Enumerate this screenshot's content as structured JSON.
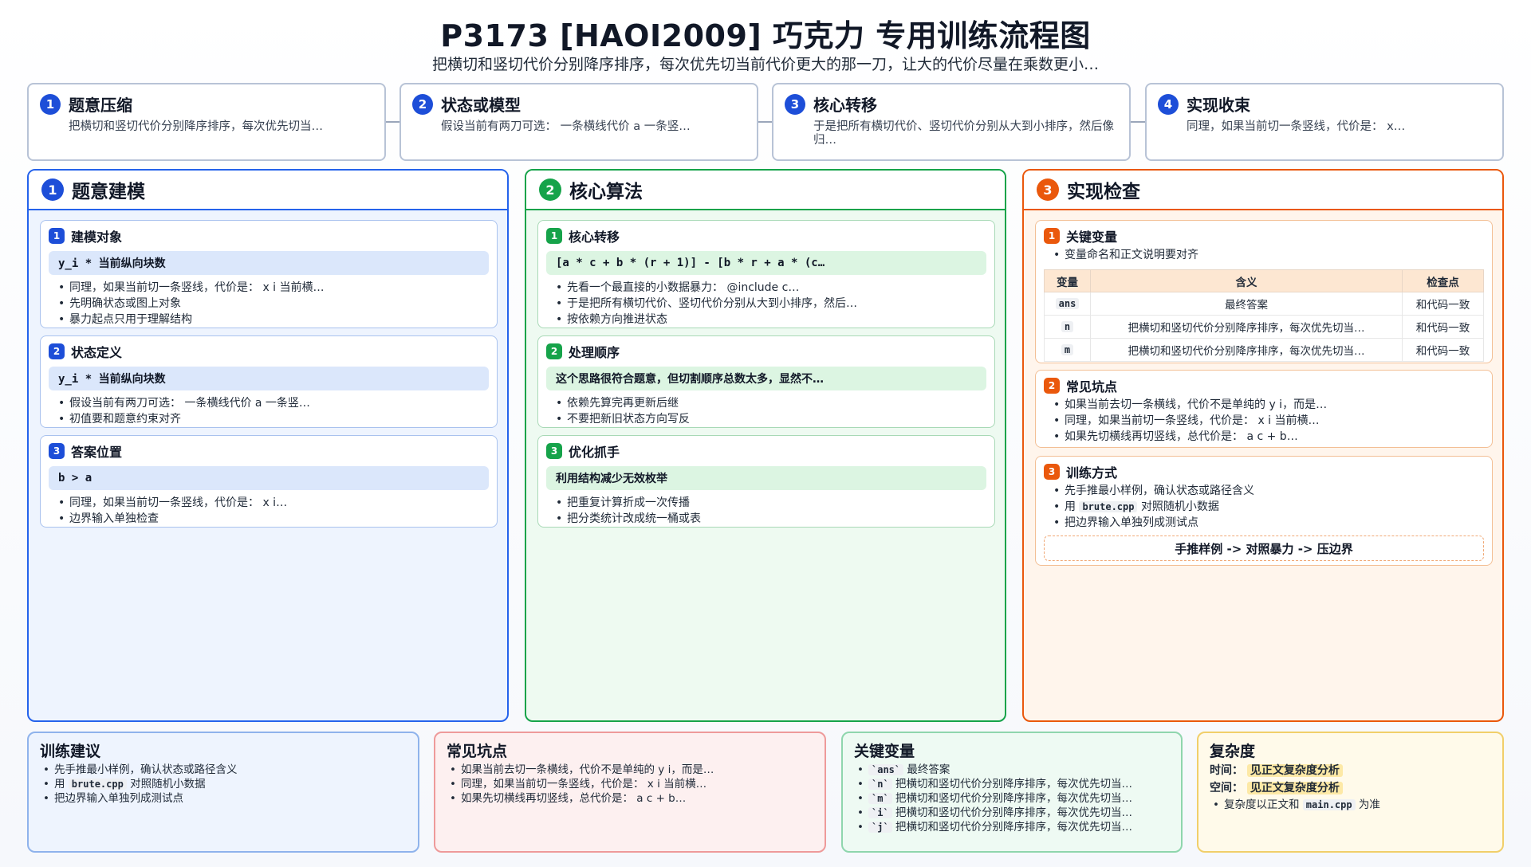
{
  "header": {
    "title": "P3173 [HAOI2009] 巧克力 专用训练流程图",
    "subtitle": "把横切和竖切代价分别降序排序，每次优先切当前代价更大的那一刀，让大的代价尽量在乘数更小…"
  },
  "steps": [
    {
      "num": "1",
      "title": "题意压缩",
      "desc": "把横切和竖切代价分别降序排序，每次优先切当…"
    },
    {
      "num": "2",
      "title": "状态或模型",
      "desc": "假设当前有两刀可选： 一条横线代价 a 一条竖…"
    },
    {
      "num": "3",
      "title": "核心转移",
      "desc": "于是把所有横切代价、竖切代价分别从大到小排序，然后像归…"
    },
    {
      "num": "4",
      "title": "实现收束",
      "desc": "同理，如果当前切一条竖线，代价是： x…"
    }
  ],
  "columns": {
    "modeling": {
      "num": "1",
      "title": "题意建模",
      "cards": [
        {
          "num": "1",
          "title": "建模对象",
          "code": "y_i * 当前纵向块数",
          "items": [
            "同理，如果当前切一条竖线，代价是： x i 当前横…",
            "先明确状态或图上对象",
            "暴力起点只用于理解结构"
          ]
        },
        {
          "num": "2",
          "title": "状态定义",
          "code": "y_i * 当前纵向块数",
          "items": [
            "假设当前有两刀可选： 一条横线代价 a 一条竖…",
            "初值要和题意约束对齐"
          ]
        },
        {
          "num": "3",
          "title": "答案位置",
          "code": "b > a",
          "items": [
            "同理，如果当前切一条竖线，代价是： x i…",
            "边界输入单独检查"
          ]
        }
      ]
    },
    "algorithm": {
      "num": "2",
      "title": "核心算法",
      "cards": [
        {
          "num": "1",
          "title": "核心转移",
          "code": "[a * c + b * (r + 1)] - [b * r + a * (c…",
          "items": [
            "先看一个最直接的小数据暴力： @include c…",
            "于是把所有横切代价、竖切代价分别从大到小排序，然后…",
            "按依赖方向推进状态"
          ]
        },
        {
          "num": "2",
          "title": "处理顺序",
          "code": "这个思路很符合题意，但切割顺序总数太多，显然不…",
          "items": [
            "依赖先算完再更新后继",
            "不要把新旧状态方向写反"
          ]
        },
        {
          "num": "3",
          "title": "优化抓手",
          "code": "利用结构减少无效枚举",
          "items": [
            "把重复计算折成一次传播",
            "把分类统计改成统一桶或表"
          ]
        }
      ]
    },
    "check": {
      "num": "3",
      "title": "实现检查",
      "vars_card": {
        "num": "1",
        "title": "关键变量",
        "bullet": "变量命名和正文说明要对齐",
        "headers": [
          "变量",
          "含义",
          "检查点"
        ],
        "rows": [
          {
            "var": "ans",
            "meaning": "最终答案",
            "check": "和代码一致"
          },
          {
            "var": "n",
            "meaning": "把横切和竖切代价分别降序排序，每次优先切当…",
            "check": "和代码一致"
          },
          {
            "var": "m",
            "meaning": "把横切和竖切代价分别降序排序，每次优先切当…",
            "check": "和代码一致"
          }
        ]
      },
      "pitfalls_card": {
        "num": "2",
        "title": "常见坑点",
        "items": [
          "如果当前去切一条横线，代价不是单纯的 y i，而是…",
          "同理，如果当前切一条竖线，代价是： x i 当前横…",
          "如果先切横线再切竖线，总代价是： a c + b…"
        ]
      },
      "training_card": {
        "num": "3",
        "title": "训练方式",
        "item1": "先手推最小样例，确认状态或路径含义",
        "item2_pre": "用",
        "item2_code": "brute.cpp",
        "item2_post": "对照随机小数据",
        "item3": "把边界输入单独列成测试点",
        "flow": "手推样例 -> 对照暴力 -> 压边界"
      }
    }
  },
  "bottom": {
    "training": {
      "title": "训练建议",
      "item1": "先手推最小样例，确认状态或路径含义",
      "item2_pre": "用",
      "item2_code": "brute.cpp",
      "item2_post": "对照随机小数据",
      "item3": "把边界输入单独列成测试点"
    },
    "pitfalls": {
      "title": "常见坑点",
      "items": [
        "如果当前去切一条横线，代价不是单纯的 y i，而是…",
        "同理，如果当前切一条竖线，代价是： x i 当前横…",
        "如果先切横线再切竖线，总代价是： a c + b…"
      ]
    },
    "vars": {
      "title": "关键变量",
      "items": [
        {
          "code": "`ans`",
          "text": "最终答案"
        },
        {
          "code": "`n`",
          "text": "把横切和竖切代价分别降序排序，每次优先切当…"
        },
        {
          "code": "`m`",
          "text": "把横切和竖切代价分别降序排序，每次优先切当…"
        },
        {
          "code": "`i`",
          "text": "把横切和竖切代价分别降序排序，每次优先切当…"
        },
        {
          "code": "`j`",
          "text": "把横切和竖切代价分别降序排序，每次优先切当…"
        }
      ]
    },
    "complexity": {
      "title": "复杂度",
      "time_label": "时间：",
      "time_value": "见正文复杂度分析",
      "space_label": "空间：",
      "space_value": "见正文复杂度分析",
      "note_pre": "复杂度以正文和",
      "note_code": "main.cpp",
      "note_post": "为准"
    }
  }
}
